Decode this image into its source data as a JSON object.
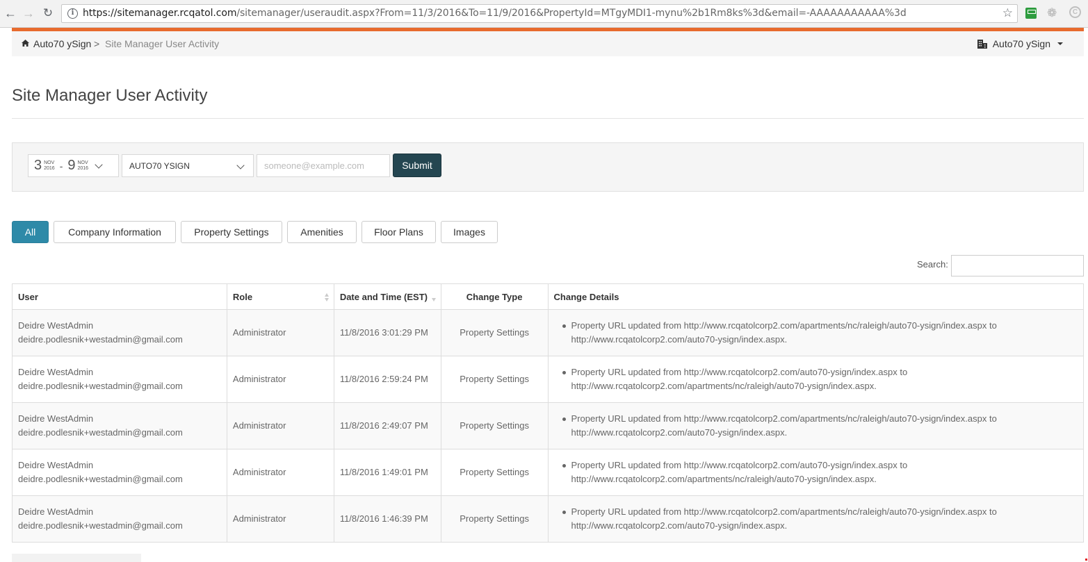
{
  "browser": {
    "url_host": "https://sitemanager.rcqatol.com",
    "url_path": "/sitemanager/useraudit.aspx?From=11/3/2016&To=11/9/2016&PropertyId=MTgyMDI1-mynu%2b1Rm8ks%3d&email=-AAAAAAAAAAA%3d"
  },
  "breadcrumb": {
    "home": "Auto70 ySign",
    "separator": ">",
    "current": "Site Manager User Activity"
  },
  "property_switcher": {
    "label": "Auto70 ySign"
  },
  "page_title": "Site Manager User Activity",
  "filters": {
    "date_from": {
      "day": "3",
      "month": "NOV",
      "year": "2016"
    },
    "date_to": {
      "day": "9",
      "month": "NOV",
      "year": "2016"
    },
    "date_separator": "-",
    "property": "AUTO70 YSIGN",
    "email_placeholder": "someone@example.com",
    "submit_label": "Submit"
  },
  "tabs": [
    {
      "label": "All",
      "active": true
    },
    {
      "label": "Company Information"
    },
    {
      "label": "Property Settings"
    },
    {
      "label": "Amenities"
    },
    {
      "label": "Floor Plans"
    },
    {
      "label": "Images"
    }
  ],
  "search": {
    "label": "Search:"
  },
  "table": {
    "headers": [
      "User",
      "Role",
      "Date and Time (EST)",
      "Change Type",
      "Change Details"
    ],
    "rows": [
      {
        "user_name": "Deidre WestAdmin",
        "user_email": "deidre.podlesnik+westadmin@gmail.com",
        "role": "Administrator",
        "datetime": "11/8/2016 3:01:29 PM",
        "change_type": "Property Settings",
        "details": "Property URL updated from http://www.rcqatolcorp2.com/apartments/nc/raleigh/auto70-ysign/index.aspx to http://www.rcqatolcorp2.com/auto70-ysign/index.aspx."
      },
      {
        "user_name": "Deidre WestAdmin",
        "user_email": "deidre.podlesnik+westadmin@gmail.com",
        "role": "Administrator",
        "datetime": "11/8/2016 2:59:24 PM",
        "change_type": "Property Settings",
        "details": "Property URL updated from http://www.rcqatolcorp2.com/auto70-ysign/index.aspx to http://www.rcqatolcorp2.com/apartments/nc/raleigh/auto70-ysign/index.aspx."
      },
      {
        "user_name": "Deidre WestAdmin",
        "user_email": "deidre.podlesnik+westadmin@gmail.com",
        "role": "Administrator",
        "datetime": "11/8/2016 2:49:07 PM",
        "change_type": "Property Settings",
        "details": "Property URL updated from http://www.rcqatolcorp2.com/apartments/nc/raleigh/auto70-ysign/index.aspx to http://www.rcqatolcorp2.com/auto70-ysign/index.aspx."
      },
      {
        "user_name": "Deidre WestAdmin",
        "user_email": "deidre.podlesnik+westadmin@gmail.com",
        "role": "Administrator",
        "datetime": "11/8/2016 1:49:01 PM",
        "change_type": "Property Settings",
        "details": "Property URL updated from http://www.rcqatolcorp2.com/auto70-ysign/index.aspx to http://www.rcqatolcorp2.com/apartments/nc/raleigh/auto70-ysign/index.aspx."
      },
      {
        "user_name": "Deidre WestAdmin",
        "user_email": "deidre.podlesnik+westadmin@gmail.com",
        "role": "Administrator",
        "datetime": "11/8/2016 1:46:39 PM",
        "change_type": "Property Settings",
        "details": "Property URL updated from http://www.rcqatolcorp2.com/apartments/nc/raleigh/auto70-ysign/index.aspx to http://www.rcqatolcorp2.com/auto70-ysign/index.aspx."
      }
    ]
  },
  "colors": {
    "accent_orange": "#e86b2e",
    "active_tab": "#2e8aa8",
    "submit_button": "#244651"
  }
}
